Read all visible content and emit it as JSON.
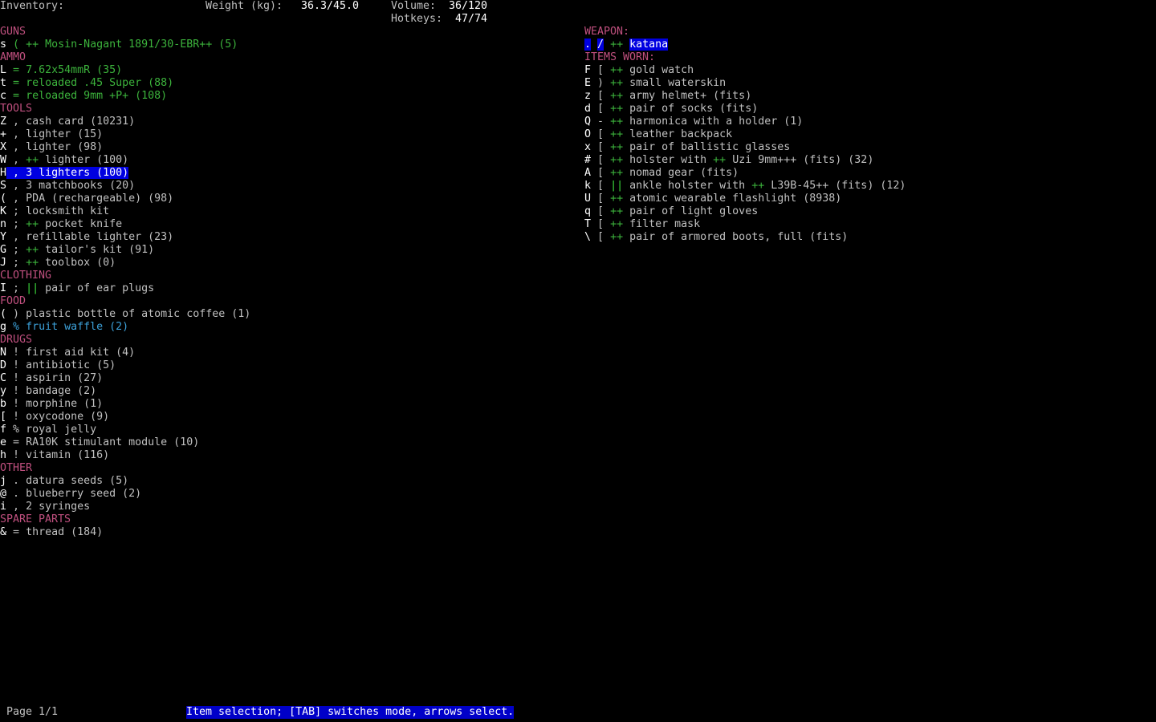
{
  "header": {
    "title": "Inventory:",
    "weight_label": "Weight (kg):",
    "weight_value": "36.3/45.0",
    "volume_label": "Volume:",
    "volume_value": "36/120",
    "hotkeys_label": "Hotkeys:",
    "hotkeys_value": "47/74"
  },
  "colors": {
    "header": "#c0507f",
    "selection": "#0000e0",
    "status_bar": "#0000c8"
  },
  "left_rows": [
    {
      "type": "header",
      "text": "GUNS"
    },
    {
      "key": "s",
      "sym": "(",
      "mark": "++",
      "text": "Mosin-Nagant 1891/30-EBR++ (5)",
      "color": "g"
    },
    {
      "type": "header",
      "text": "AMMO"
    },
    {
      "key": "L",
      "sym": "=",
      "text": "7.62x54mmR (35)",
      "color": "g"
    },
    {
      "key": "t",
      "sym": "=",
      "text": "reloaded .45 Super (88)",
      "color": "g"
    },
    {
      "key": "c",
      "sym": "=",
      "text": "reloaded 9mm +P+ (108)",
      "color": "g"
    },
    {
      "type": "header",
      "text": "TOOLS"
    },
    {
      "key": "Z",
      "sym": ",",
      "text": "cash card (10231)"
    },
    {
      "key": "+",
      "sym": ",",
      "text": "lighter (15)"
    },
    {
      "key": "X",
      "sym": ",",
      "text": "lighter (98)"
    },
    {
      "key": "W",
      "sym": ",",
      "mark": "++",
      "text": "lighter (100)"
    },
    {
      "key": "H",
      "sym": ",",
      "text": "3 lighters (100)",
      "selected": true
    },
    {
      "key": "S",
      "sym": ",",
      "text": "3 matchbooks (20)"
    },
    {
      "key": "(",
      "sym": ",",
      "text": "PDA (rechargeable) (98)"
    },
    {
      "key": "K",
      "sym": ";",
      "text": "locksmith kit"
    },
    {
      "key": "n",
      "sym": ";",
      "mark": "++",
      "text": "pocket knife"
    },
    {
      "key": "Y",
      "sym": ",",
      "text": "refillable lighter (23)"
    },
    {
      "key": "G",
      "sym": ";",
      "mark": "++",
      "text": "tailor's kit (91)"
    },
    {
      "key": "J",
      "sym": ";",
      "mark": "++",
      "text": "toolbox (0)"
    },
    {
      "type": "header",
      "text": "CLOTHING"
    },
    {
      "key": "I",
      "sym": ";",
      "mark": "||",
      "text": "pair of ear plugs"
    },
    {
      "type": "header",
      "text": "FOOD"
    },
    {
      "key": "(",
      "sym": ")",
      "text": "plastic bottle of atomic coffee (1)"
    },
    {
      "key": "g",
      "sym": "%",
      "text": "fruit waffle (2)",
      "color": "cy"
    },
    {
      "type": "header",
      "text": "DRUGS"
    },
    {
      "key": "N",
      "sym": "!",
      "text": "first aid kit (4)"
    },
    {
      "key": "D",
      "sym": "!",
      "text": "antibiotic (5)"
    },
    {
      "key": "C",
      "sym": "!",
      "text": "aspirin (27)"
    },
    {
      "key": "y",
      "sym": "!",
      "text": "bandage (2)"
    },
    {
      "key": "b",
      "sym": "!",
      "text": "morphine (1)"
    },
    {
      "key": "[",
      "sym": "!",
      "text": "oxycodone (9)"
    },
    {
      "key": "f",
      "sym": "%",
      "text": "royal jelly"
    },
    {
      "key": "e",
      "sym": "=",
      "text": "RA10K stimulant module (10)"
    },
    {
      "key": "h",
      "sym": "!",
      "text": "vitamin (116)"
    },
    {
      "type": "header",
      "text": "OTHER"
    },
    {
      "key": "j",
      "sym": ".",
      "text": "datura seeds (5)"
    },
    {
      "key": "@",
      "sym": ".",
      "text": "blueberry seed (2)"
    },
    {
      "key": "i",
      "sym": ",",
      "text": "2 syringes"
    },
    {
      "type": "header",
      "text": "SPARE PARTS"
    },
    {
      "key": "&",
      "sym": "=",
      "text": "thread (184)"
    }
  ],
  "right_rows": [
    {
      "type": "header",
      "text": "WEAPON:"
    },
    {
      "key": ".",
      "sym": "/",
      "mark": "++",
      "text": "katana",
      "weapon": true
    },
    {
      "type": "header",
      "text": "ITEMS WORN:"
    },
    {
      "key": "F",
      "sym": "[",
      "mark": "++",
      "text": "gold watch"
    },
    {
      "key": "E",
      "sym": ")",
      "mark": "++",
      "text": "small waterskin"
    },
    {
      "key": "z",
      "sym": "[",
      "mark": "++",
      "text": "army helmet+ (fits)"
    },
    {
      "key": "d",
      "sym": "[",
      "mark": "++",
      "text": "pair of socks (fits)"
    },
    {
      "key": "Q",
      "sym": "-",
      "mark": "++",
      "text": "harmonica with a holder (1)"
    },
    {
      "key": "O",
      "sym": "[",
      "mark": "++",
      "text": "leather backpack"
    },
    {
      "key": "x",
      "sym": "[",
      "mark": "++",
      "text": "pair of ballistic glasses"
    },
    {
      "key": "#",
      "sym": "[",
      "mark": "++",
      "text": "holster with ",
      "mark2": "++",
      "text2": "Uzi 9mm+++ (fits) (32)"
    },
    {
      "key": "A",
      "sym": "[",
      "mark": "++",
      "text": "nomad gear (fits)"
    },
    {
      "key": "k",
      "sym": "[",
      "mark": "||",
      "text": "ankle holster with ",
      "mark2": "++",
      "text2": "L39B-45++ (fits) (12)"
    },
    {
      "key": "U",
      "sym": "[",
      "mark": "++",
      "text": "atomic wearable flashlight (8938)"
    },
    {
      "key": "q",
      "sym": "[",
      "mark": "++",
      "text": "pair of light gloves"
    },
    {
      "key": "T",
      "sym": "[",
      "mark": "++",
      "text": "filter mask"
    },
    {
      "key": "\\",
      "sym": "[",
      "mark": "++",
      "text": "pair of armored boots, full (fits)"
    }
  ],
  "footer": {
    "page": "Page 1/1",
    "status": "Item selection; [TAB] switches mode, arrows select."
  }
}
